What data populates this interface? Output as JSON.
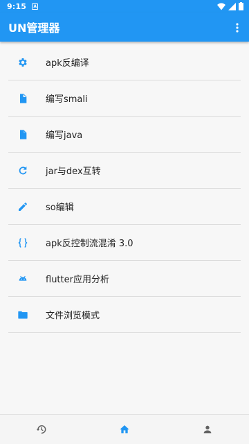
{
  "status_bar": {
    "time": "9:15",
    "notification_glyph": "A"
  },
  "app_bar": {
    "title": "UN管理器",
    "menu_icon": "more-vert-icon"
  },
  "colors": {
    "primary": "#2196f3",
    "nav_inactive": "#616161",
    "divider": "#dcdcdc"
  },
  "menu": {
    "items": [
      {
        "label": "apk反编译",
        "icon": "gear-icon"
      },
      {
        "label": "编写smali",
        "icon": "file-icon"
      },
      {
        "label": "编写java",
        "icon": "file-icon"
      },
      {
        "label": "jar与dex互转",
        "icon": "refresh-icon"
      },
      {
        "label": "so编辑",
        "icon": "pencil-icon"
      },
      {
        "label": "apk反控制流混淆 3.0",
        "icon": "braces-icon"
      },
      {
        "label": "flutter应用分析",
        "icon": "android-icon"
      },
      {
        "label": "文件浏览模式",
        "icon": "folder-icon"
      }
    ]
  },
  "bottom_nav": {
    "items": [
      {
        "icon": "history-icon",
        "active": false
      },
      {
        "icon": "home-icon",
        "active": true
      },
      {
        "icon": "person-icon",
        "active": false
      }
    ]
  }
}
